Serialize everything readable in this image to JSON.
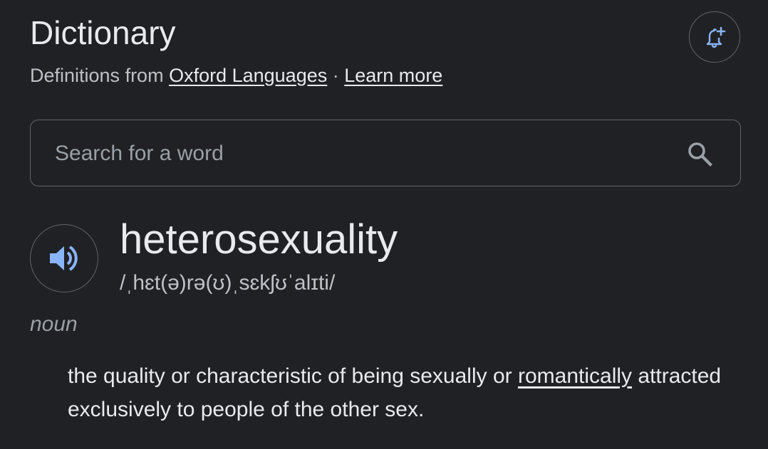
{
  "header": {
    "title": "Dictionary",
    "subtitle_prefix": "Definitions from ",
    "source_link": "Oxford Languages",
    "separator": " · ",
    "learn_more": "Learn more",
    "alert_icon": "bell-plus-icon"
  },
  "search": {
    "placeholder": "Search for a word",
    "value": "",
    "icon": "search-icon"
  },
  "entry": {
    "audio_icon": "speaker-icon",
    "headword": "heterosexuality",
    "phonetic": "/ˌhɛt(ə)rə(ʊ)ˌsɛkʃʊˈalɪti/",
    "part_of_speech": "noun",
    "definition_part1": "the quality or characteristic of being sexually or ",
    "definition_link": "romantically",
    "definition_part2": " attracted exclusively to people of the other sex."
  },
  "colors": {
    "background": "#202124",
    "text_primary": "#e8eaed",
    "text_secondary": "#bdc1c6",
    "accent_blue": "#8ab4f8",
    "border": "#5f6368"
  }
}
